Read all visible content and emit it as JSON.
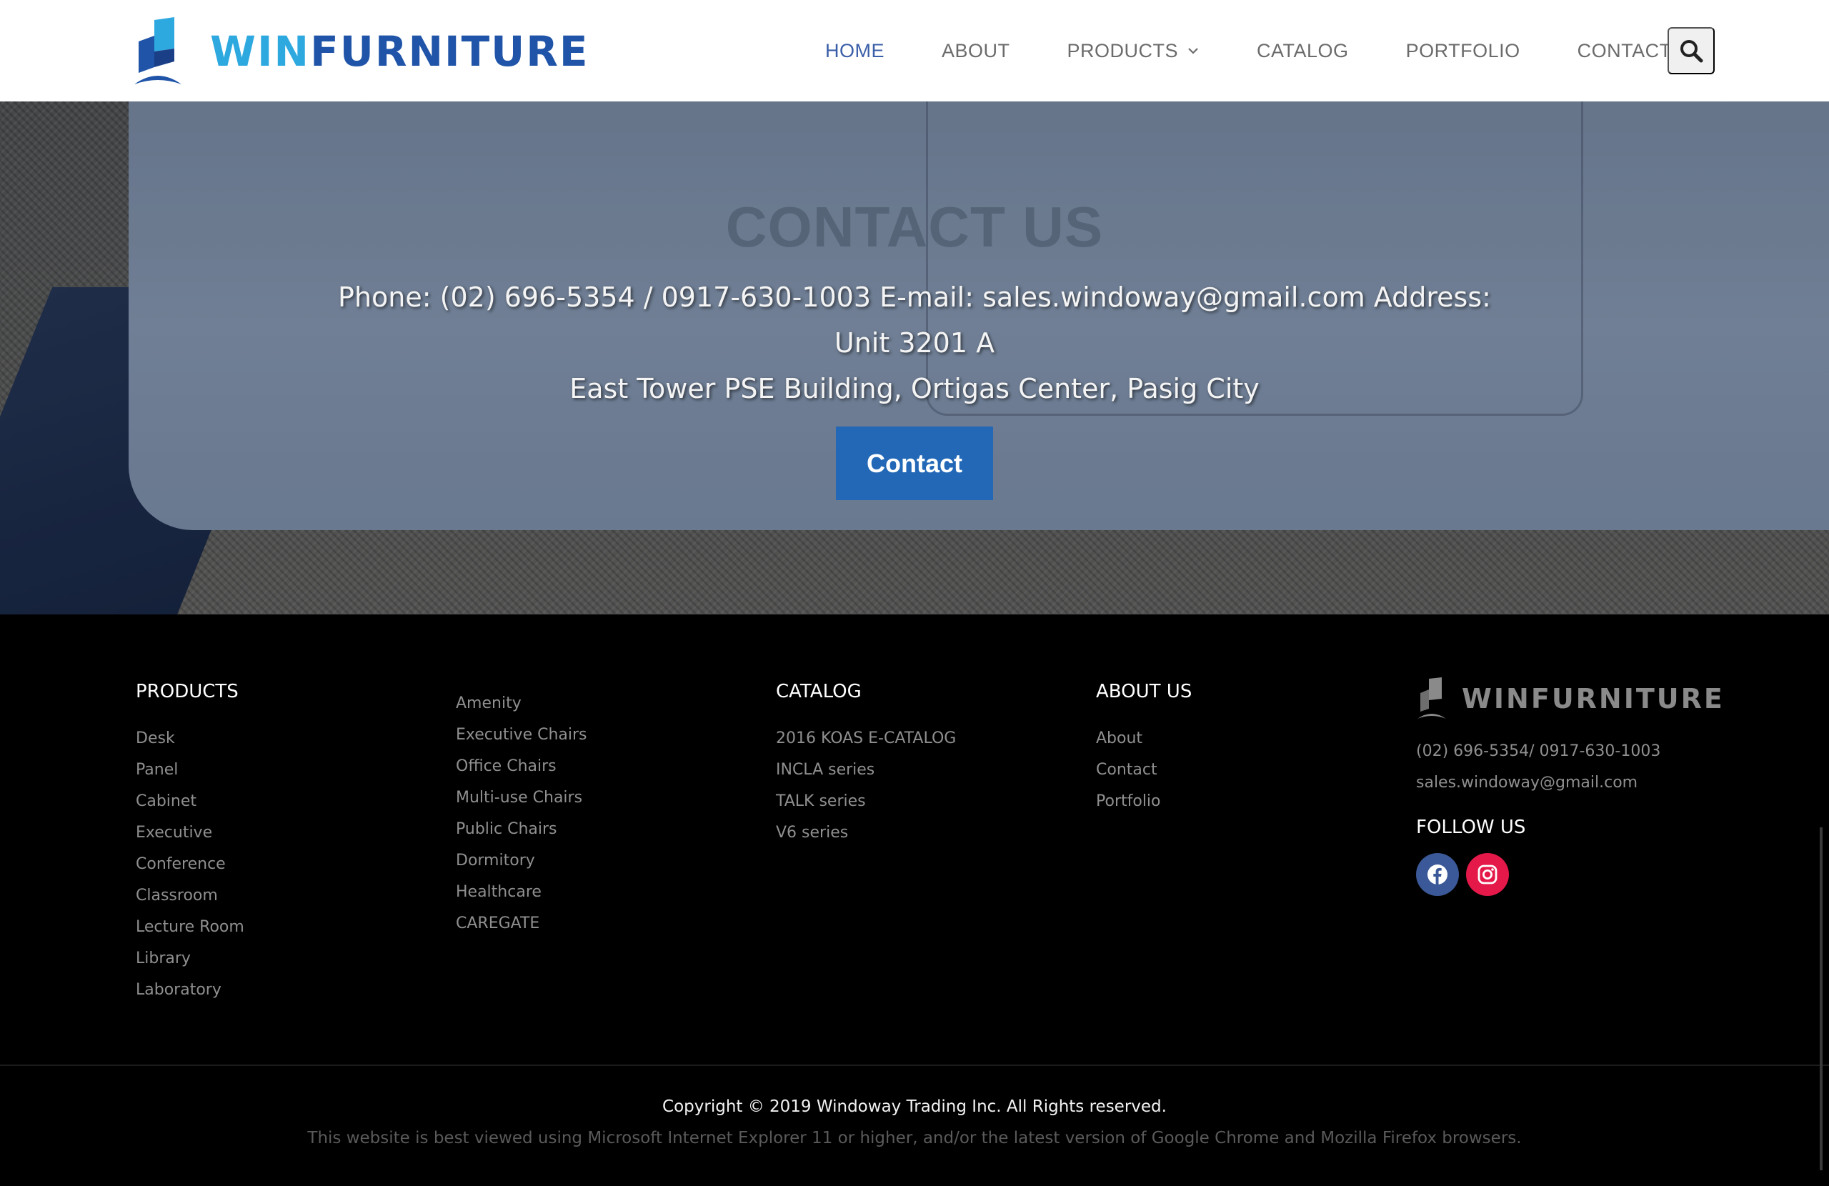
{
  "brand": {
    "name_a": "WIN",
    "name_b": "FURNITURE"
  },
  "nav": {
    "items": [
      {
        "label": "HOME",
        "active": true
      },
      {
        "label": "ABOUT",
        "active": false
      },
      {
        "label": "PRODUCTS",
        "active": false,
        "dropdown": true
      },
      {
        "label": "CATALOG",
        "active": false
      },
      {
        "label": "PORTFOLIO",
        "active": false
      },
      {
        "label": "CONTACT",
        "active": false
      }
    ],
    "search_icon": "search-icon"
  },
  "hero": {
    "title": "CONTACT US",
    "info_line1": "Phone: (02) 696-5354 / 0917-630-1003 E-mail: sales.windoway@gmail.com Address: Unit 3201 A",
    "info_line2": "East Tower PSE Building, Ortigas Center, Pasig City",
    "button_label": "Contact"
  },
  "footer": {
    "products": {
      "title": "PRODUCTS",
      "items": [
        "Desk",
        "Panel",
        "Cabinet",
        "Executive",
        "Conference",
        "Classroom",
        "Lecture Room",
        "Library",
        "Laboratory"
      ]
    },
    "chairs": {
      "items": [
        "Amenity",
        "Executive Chairs",
        "Office Chairs",
        "Multi-use Chairs",
        "Public Chairs",
        "Dormitory",
        "Healthcare",
        "CAREGATE"
      ]
    },
    "catalog": {
      "title": "CATALOG",
      "items": [
        "2016 KOAS E-CATALOG",
        "INCLA series",
        "TALK series",
        "V6 series"
      ]
    },
    "about": {
      "title": "ABOUT US",
      "items": [
        "About",
        "Contact",
        "Portfolio"
      ]
    },
    "brand_text": "WINFURNITURE",
    "phone": "(02) 696-5354/ 0917-630-1003",
    "email": "sales.windoway@gmail.com",
    "follow_title": "FOLLOW US",
    "social": [
      "facebook-icon",
      "instagram-icon"
    ],
    "copyright": "Copyright © 2019 Windoway Trading Inc. All Rights reserved.",
    "browser_note": "This website is best viewed using Microsoft Internet Explorer 11 or higher, and/or the latest version of Google Chrome and Mozilla Firefox browsers."
  },
  "colors": {
    "accent": "#2268b6",
    "nav_active": "#3a5ea8",
    "logo_light": "#2ea9e0",
    "logo_dark": "#1f54a8",
    "facebook": "#3b5998",
    "instagram": "#e4194a"
  }
}
